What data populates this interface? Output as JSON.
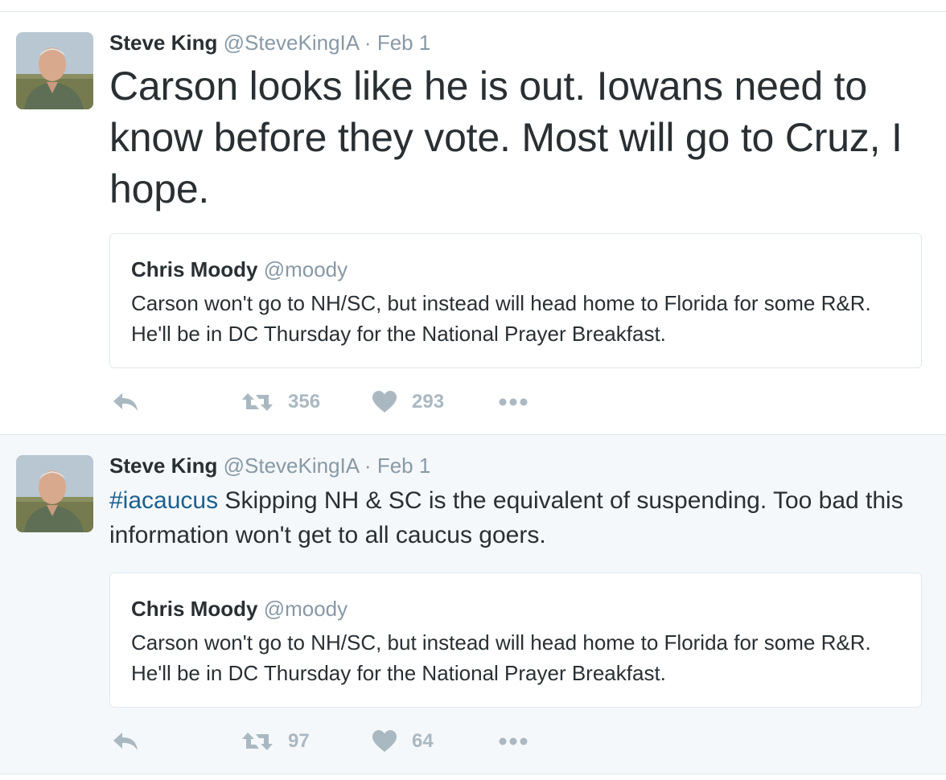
{
  "tweets": [
    {
      "author": {
        "name": "Steve King",
        "handle": "@SteveKingIA",
        "separator": "·",
        "date": "Feb 1",
        "avatar_icon": "profile-photo"
      },
      "text": "Carson looks like he is out. Iowans need to know before they vote. Most will go to Cruz, I hope.",
      "quote": {
        "name": "Chris Moody",
        "handle": "@moody",
        "text": "Carson won't go to NH/SC, but instead will head home to Florida for some R&R. He'll be in DC Thursday for the National Prayer Breakfast."
      },
      "actions": {
        "retweets": "356",
        "likes": "293"
      }
    },
    {
      "author": {
        "name": "Steve King",
        "handle": "@SteveKingIA",
        "separator": "·",
        "date": "Feb 1",
        "avatar_icon": "profile-photo"
      },
      "hashtag": "#iacaucus",
      "text": " Skipping NH & SC is the equivalent of suspending. Too bad this information won't get to all caucus goers.",
      "quote": {
        "name": "Chris Moody",
        "handle": "@moody",
        "text": "Carson won't go to NH/SC, but instead will head home to Florida for some R&R. He'll be in DC Thursday for the National Prayer Breakfast."
      },
      "actions": {
        "retweets": "97",
        "likes": "64"
      }
    }
  ],
  "icons": {
    "reply": "reply-icon",
    "retweet": "retweet-icon",
    "like": "heart-icon",
    "more": "more-icon"
  },
  "colors": {
    "text": "#292f33",
    "muted": "#8899a6",
    "action_gray": "#aab8c2",
    "hashtag": "#1b5f8f",
    "border": "#e1e8ed",
    "highlight_bg": "#f5f8fa"
  }
}
